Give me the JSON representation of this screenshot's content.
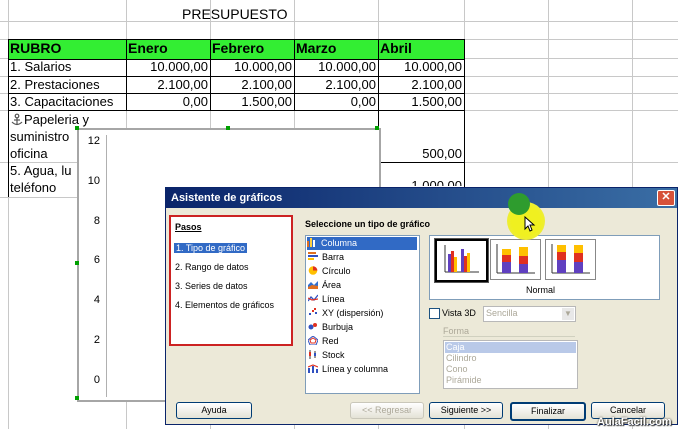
{
  "sheet": {
    "title": "PRESUPUESTO",
    "headers": [
      "RUBRO",
      "Enero",
      "Febrero",
      "Marzo",
      "Abril"
    ],
    "rows": [
      {
        "rubro": "1. Salarios",
        "enero": "10.000,00",
        "febrero": "10.000,00",
        "marzo": "10.000,00",
        "abril": "10.000,00"
      },
      {
        "rubro": "2. Prestaciones",
        "enero": "2.100,00",
        "febrero": "2.100,00",
        "marzo": "2.100,00",
        "abril": "2.100,00"
      },
      {
        "rubro": "3. Capacitaciones",
        "enero": "0,00",
        "febrero": "1.500,00",
        "marzo": "0,00",
        "abril": "1.500,00"
      }
    ],
    "row4_lines": [
      "Papeleria y",
      "suministro",
      "oficina"
    ],
    "row4_abril": "500,00",
    "row5_lines": [
      "5. Agua, lu",
      "teléfono"
    ],
    "row5_abril_partial": "1.000,00",
    "colors": {
      "header_green": "#33ee33",
      "grid": "#c8c8c8"
    }
  },
  "chart": {
    "y_ticks": [
      "12",
      "10",
      "8",
      "6",
      "4",
      "2",
      "0"
    ],
    "anchor_icon": "anchor-icon"
  },
  "dialog": {
    "title": "Asistente de gráficos",
    "steps_heading": "Pasos",
    "steps": [
      "1. Tipo de gráfico",
      "2. Rango de datos",
      "3. Series de datos",
      "4. Elementos de gráficos"
    ],
    "type_heading": "Seleccione un tipo de gráfico",
    "types": [
      {
        "label": "Columna",
        "icon": "column-chart-icon"
      },
      {
        "label": "Barra",
        "icon": "bar-chart-icon"
      },
      {
        "label": "Círculo",
        "icon": "pie-chart-icon"
      },
      {
        "label": "Área",
        "icon": "area-chart-icon"
      },
      {
        "label": "Línea",
        "icon": "line-chart-icon"
      },
      {
        "label": "XY (dispersión)",
        "icon": "scatter-chart-icon"
      },
      {
        "label": "Burbuja",
        "icon": "bubble-chart-icon"
      },
      {
        "label": "Red",
        "icon": "net-chart-icon"
      },
      {
        "label": "Stock",
        "icon": "stock-chart-icon"
      },
      {
        "label": "Línea y columna",
        "icon": "line-column-chart-icon"
      }
    ],
    "variant_label": "Normal",
    "vista3d_label": "Vista 3D",
    "vista3d_select": "Sencilla",
    "forma_label": "Forma",
    "formas": [
      "Caja",
      "Cilindro",
      "Cono",
      "Pirámide"
    ],
    "buttons": {
      "help": "Ayuda",
      "back": "<< Regresar",
      "next": "Siguiente >>",
      "finish": "Finalizar",
      "cancel": "Cancelar"
    },
    "accent": "#316ac5",
    "highlight_border": "#cc2222"
  },
  "watermark": "AulaFacil.com"
}
